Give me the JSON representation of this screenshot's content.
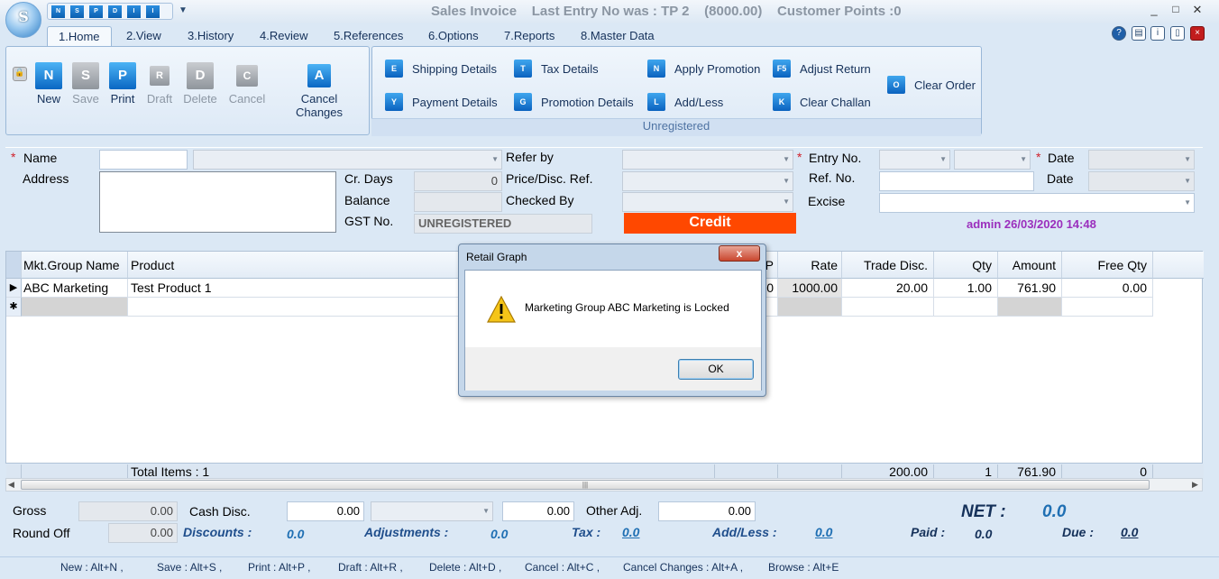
{
  "window": {
    "title": "Sales Invoice    Last Entry No was : TP 2    (8000.00)    Customer Points :0",
    "minimize": "_",
    "maximize": "□",
    "close": "✕",
    "logo": "S",
    "quick_access": [
      "N",
      "S",
      "P",
      "D",
      "I",
      "I"
    ]
  },
  "tabs": [
    "1.Home",
    "2.View",
    "3.History",
    "4.Review",
    "5.References",
    "6.Options",
    "7.Reports",
    "8.Master Data"
  ],
  "ribbon": {
    "main": [
      {
        "label": "New",
        "key": "N",
        "enabled": true
      },
      {
        "label": "Save",
        "key": "S",
        "enabled": false
      },
      {
        "label": "Print",
        "key": "P",
        "enabled": true
      },
      {
        "label": "Draft",
        "key": "R",
        "enabled": false
      },
      {
        "label": "Delete",
        "key": "D",
        "enabled": false
      },
      {
        "label": "Cancel",
        "key": "C",
        "enabled": false
      },
      {
        "label": "Cancel Changes",
        "key": "A",
        "enabled": true
      }
    ],
    "shortcuts": [
      {
        "label": "Shipping Details",
        "key": "E"
      },
      {
        "label": "Payment Details",
        "key": "Y"
      },
      {
        "label": "Tax Details",
        "key": "T"
      },
      {
        "label": "Promotion Details",
        "key": "G"
      },
      {
        "label": "Apply Promotion",
        "key": "N"
      },
      {
        "label": "Add/Less",
        "key": "L"
      },
      {
        "label": "Adjust Return",
        "key": "F5"
      },
      {
        "label": "Clear Challan",
        "key": "K"
      },
      {
        "label": "Clear Order",
        "key": "O"
      }
    ],
    "unregistered": "Unregistered"
  },
  "form": {
    "name_label": "Name",
    "address_label": "Address",
    "cr_days_label": "Cr. Days",
    "cr_days_value": "0",
    "balance_label": "Balance",
    "gst_label": "GST No.",
    "gst_value": "UNREGISTERED",
    "refer_by_label": "Refer by",
    "price_ref_label": "Price/Disc. Ref.",
    "checked_by_label": "Checked By",
    "credit_label": "Credit",
    "entry_no_label": "Entry No.",
    "date_label": "Date",
    "ref_no_label": "Ref. No.",
    "date2_label": "Date",
    "excise_label": "Excise",
    "stamp": "admin 26/03/2020 14:48",
    "required_mark": "*"
  },
  "grid": {
    "headers": [
      "Mkt.Group Name",
      "Product",
      "P",
      "Rate",
      "Trade Disc.",
      "Qty",
      "Amount",
      "Free Qty"
    ],
    "rows": [
      {
        "marker": "▶",
        "group": "ABC Marketing",
        "product": "Test Product 1",
        "p": "0",
        "rate": "1000.00",
        "trade_disc": "20.00",
        "qty": "1.00",
        "amount": "761.90",
        "free_qty": "0.00"
      }
    ],
    "new_row_marker": "✱",
    "totals": {
      "items": "Total Items : 1",
      "trade_disc": "200.00",
      "qty": "1",
      "amount": "761.90",
      "free_qty": "0"
    },
    "scroll_grip": "|||"
  },
  "dialog": {
    "title": "Retail Graph",
    "close": "x",
    "message": "Marketing Group ABC Marketing is Locked",
    "ok": "OK"
  },
  "footer": {
    "gross_label": "Gross",
    "gross_value": "0.00",
    "round_off_label": "Round Off",
    "round_off_value": "0.00",
    "cash_disc_label": "Cash Disc.",
    "cash_disc_value": "0.00",
    "cash_disc_pct": "0.00",
    "other_adj_label": "Other Adj.",
    "other_adj_value": "0.00",
    "discounts_label": "Discounts :",
    "discounts_value": "0.0",
    "adjustments_label": "Adjustments :",
    "adjustments_value": "0.0",
    "tax_label": "Tax :",
    "tax_value": "0.0",
    "addless_label": "Add/Less :",
    "addless_value": "0.0",
    "net_label": "NET :",
    "net_value": "0.0",
    "paid_label": "Paid :",
    "paid_value": "0.0",
    "due_label": "Due :",
    "due_value": "0.0"
  },
  "hotkeys": [
    "New : Alt+N ,",
    "Save : Alt+S ,",
    "Print : Alt+P ,",
    "Draft : Alt+R ,",
    "Delete : Alt+D ,",
    "Cancel : Alt+C ,",
    "Cancel Changes : Alt+A ,",
    "Browse : Alt+E"
  ]
}
